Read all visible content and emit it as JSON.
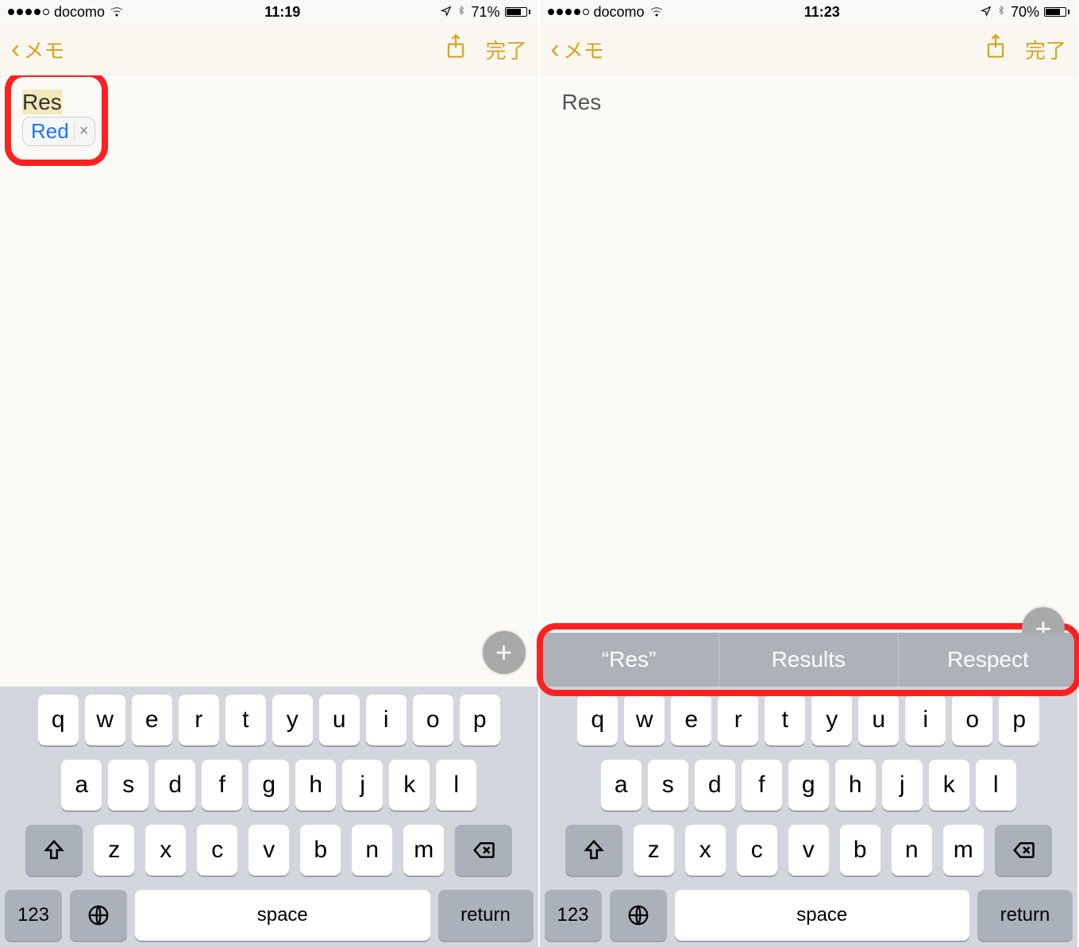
{
  "screens": [
    {
      "status": {
        "carrier": "docomo",
        "time": "11:19",
        "battery_pct": "71%",
        "signal_filled": 4,
        "signal_total": 5
      },
      "nav": {
        "back_label": "メモ",
        "done_label": "完了"
      },
      "note": {
        "text": "Res",
        "autocorrect_suggestion": "Red",
        "highlighted": true
      },
      "quicktype": null,
      "keyboard": {
        "row1": [
          "q",
          "w",
          "e",
          "r",
          "t",
          "y",
          "u",
          "i",
          "o",
          "p"
        ],
        "row2": [
          "a",
          "s",
          "d",
          "f",
          "g",
          "h",
          "j",
          "k",
          "l"
        ],
        "row3": [
          "z",
          "x",
          "c",
          "v",
          "b",
          "n",
          "m"
        ],
        "numkey": "123",
        "space": "space",
        "return": "return"
      }
    },
    {
      "status": {
        "carrier": "docomo",
        "time": "11:23",
        "battery_pct": "70%",
        "signal_filled": 4,
        "signal_total": 5
      },
      "nav": {
        "back_label": "メモ",
        "done_label": "完了"
      },
      "note": {
        "text": "Res",
        "autocorrect_suggestion": null,
        "highlighted": false
      },
      "quicktype": [
        "“Res”",
        "Results",
        "Respect"
      ],
      "keyboard": {
        "row1": [
          "q",
          "w",
          "e",
          "r",
          "t",
          "y",
          "u",
          "i",
          "o",
          "p"
        ],
        "row2": [
          "a",
          "s",
          "d",
          "f",
          "g",
          "h",
          "j",
          "k",
          "l"
        ],
        "row3": [
          "z",
          "x",
          "c",
          "v",
          "b",
          "n",
          "m"
        ],
        "numkey": "123",
        "space": "space",
        "return": "return"
      }
    }
  ]
}
